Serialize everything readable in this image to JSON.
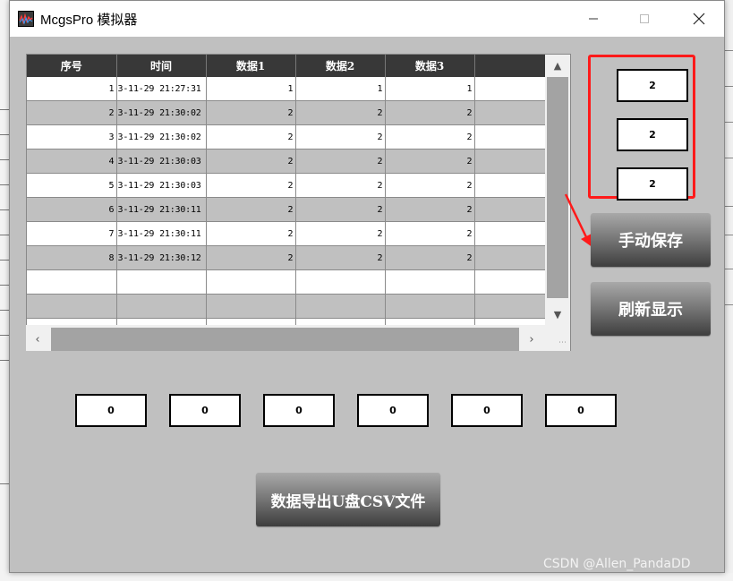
{
  "window": {
    "title": "McgsPro 模拟器"
  },
  "table": {
    "headers": [
      "序号",
      "时间",
      "数据1",
      "数据2",
      "数据3"
    ],
    "rows": [
      [
        "1",
        "3-11-29 21:27:31",
        "1",
        "1",
        "1"
      ],
      [
        "2",
        "3-11-29 21:30:02",
        "2",
        "2",
        "2"
      ],
      [
        "3",
        "3-11-29 21:30:02",
        "2",
        "2",
        "2"
      ],
      [
        "4",
        "3-11-29 21:30:03",
        "2",
        "2",
        "2"
      ],
      [
        "5",
        "3-11-29 21:30:03",
        "2",
        "2",
        "2"
      ],
      [
        "6",
        "3-11-29 21:30:11",
        "2",
        "2",
        "2"
      ],
      [
        "7",
        "3-11-29 21:30:11",
        "2",
        "2",
        "2"
      ],
      [
        "8",
        "3-11-29 21:30:12",
        "2",
        "2",
        "2"
      ]
    ],
    "empty_rows": 3
  },
  "current_values": [
    "2",
    "2",
    "2"
  ],
  "bottom_values": [
    "0",
    "0",
    "0",
    "0",
    "0",
    "0"
  ],
  "buttons": {
    "manual_save": "手动保存",
    "refresh": "刷新显示",
    "export": "数据导出U盘CSV文件"
  },
  "annotation": {
    "highlight_color": "#ff1a1a"
  },
  "watermark": "CSDN @Allen_PandaDD"
}
